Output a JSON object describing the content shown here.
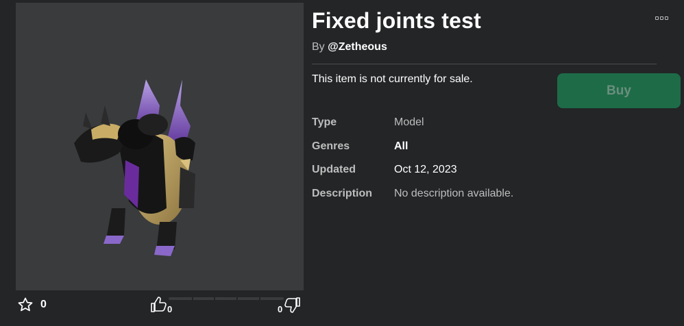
{
  "item": {
    "title": "Fixed joints test",
    "by_prefix": "By",
    "creator": "@Zetheous",
    "sale_note": "This item is not currently for sale.",
    "buy_label": "Buy",
    "thumbnail_icon": "dragon-model-thumbnail"
  },
  "details": [
    {
      "key": "Type",
      "value": "Model"
    },
    {
      "key": "Genres",
      "value": "All"
    },
    {
      "key": "Updated",
      "value": "Oct 12, 2023"
    },
    {
      "key": "Description",
      "value": "No description available."
    }
  ],
  "social": {
    "favorites": "0",
    "upvotes": "0",
    "downvotes": "0"
  },
  "colors": {
    "background": "#232527",
    "thumb_bg": "#393b3d",
    "buy_bg": "#1e6b48",
    "muted_text": "#bdbebe"
  }
}
